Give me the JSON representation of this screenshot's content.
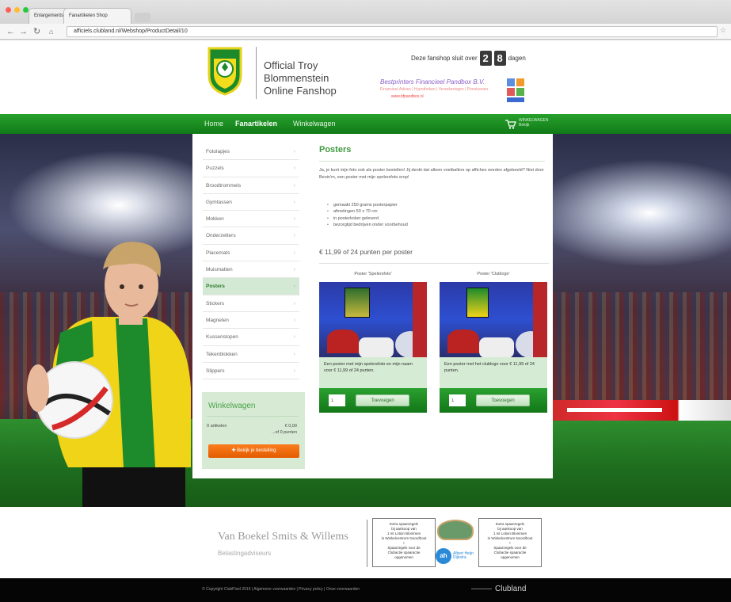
{
  "browser": {
    "tabs": [
      {
        "label": "Enlargements Settings"
      },
      {
        "label": "Fanartikelen Shop"
      }
    ],
    "url": "afficiels.clubland.nl/Webshop/ProductDetail/10",
    "traffic_colors": [
      "#ff5f56",
      "#ffbd2e",
      "#27c93f"
    ]
  },
  "header": {
    "title_lines": [
      "Official Troy",
      "Blommenstein",
      "Online Fanshop"
    ],
    "closing_prefix": "Deze fanshop sluit over",
    "closing_digits": [
      "2",
      "8"
    ],
    "closing_suffix": "dagen",
    "sponsor": {
      "name": "Bestprinters Financieel Pandbox B.V.",
      "tagline": "Financieel Advies | Hypotheken | Verzekeringen | Pensioenen",
      "url": "www.bfpandbox.nl"
    }
  },
  "nav": {
    "items": [
      {
        "label": "Home",
        "active": false
      },
      {
        "label": "Fanartikelen",
        "active": true
      },
      {
        "label": "Winkelwagen",
        "active": false
      }
    ],
    "cart_label": "WINKELWAGEN\nBekijk"
  },
  "sidebar": {
    "items": [
      {
        "label": "Fotolapjes",
        "active": false
      },
      {
        "label": "Puzzels",
        "active": false
      },
      {
        "label": "Broodtrommels",
        "active": false
      },
      {
        "label": "Gymtassen",
        "active": false
      },
      {
        "label": "Mokken",
        "active": false
      },
      {
        "label": "Onderzetters",
        "active": false
      },
      {
        "label": "Placemats",
        "active": false
      },
      {
        "label": "Muismatten",
        "active": false
      },
      {
        "label": "Posters",
        "active": true
      },
      {
        "label": "Stickers",
        "active": false
      },
      {
        "label": "Magneten",
        "active": false
      },
      {
        "label": "Kussenslopen",
        "active": false
      },
      {
        "label": "Tekenblokken",
        "active": false
      },
      {
        "label": "Slippers",
        "active": false
      }
    ]
  },
  "cart": {
    "title": "Winkelwagen",
    "count": "0 artikelen",
    "amount": "€ 0,00",
    "points": "...of 0 punten",
    "order_button": "✚ Bekijk je bestelling"
  },
  "main": {
    "title": "Posters",
    "intro": "Ja, je kunt mijn foto ook als poster bestellen! Jij denkt dat alleen voetballers op affiches worden afgebeeld? Niet door Beoin'm, een poster met mijn spelersfoto erop!",
    "specs": [
      "gemaakt 250 grams posterpapier",
      "afmetingen 50 x 70 cm",
      "in posterkoker geleverd",
      "bezorgtijd bedrijven onder voorbehoud"
    ],
    "price_line": "€ 11,99 of 24 punten per poster",
    "products": [
      {
        "name": "Poster 'Spelersfoto'",
        "description": "Een poster met mijn spelersfoto en mijn naam voor € 11,99 of 24 punten.",
        "qty": "1",
        "button": "Toevoegen"
      },
      {
        "name": "Poster 'Clublogo'",
        "description": "Een poster met het clublogo voor € 11,99 of 24 punten.",
        "qty": "1",
        "button": "Toevoegen"
      }
    ]
  },
  "sponsors": {
    "firm_name": "Van Boekel Smits & Willems",
    "firm_sub": "Belastingadviseurs",
    "card1": "Extra spaarzegels\nbij aankoop van\n1 ml Lotion Blommen\nin Winkelcentrum Noordhout\n+\nSpaarzegels voor de\nClubactie spaaractie\nopgenomen",
    "card2": "Extra spaarzegels\nbij aankoop van\n1 ml Lotion Blommen\nin Winkelcentrum Noordhout\n+\nSpaarzegels voor de\nClubactie spaaractie\nopgenomen",
    "ah_text": "Albert Heijn\nDijkstra"
  },
  "footer": {
    "copyright": "© Copyright ClubPixel 2016 | Algemene voorwaarden | Privacy policy | Onze voorwaarden",
    "brand": "Clubland"
  }
}
